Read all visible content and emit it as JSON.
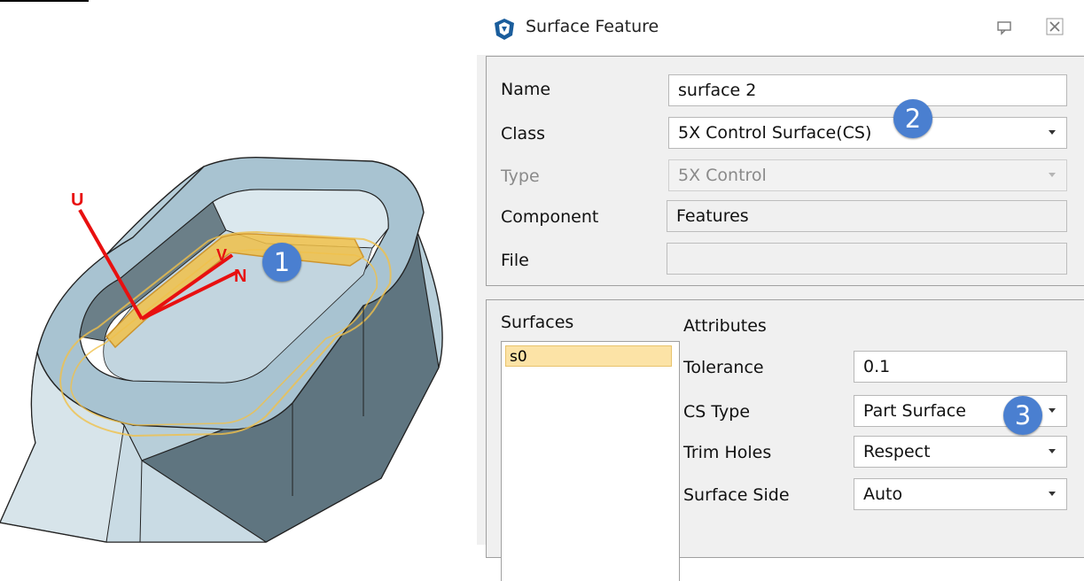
{
  "dialog": {
    "title": "Surface Feature",
    "icons": {
      "app": "surface-feature-icon",
      "pin": "pin-icon",
      "close": "close-icon"
    }
  },
  "properties": {
    "name_label": "Name",
    "name_value": "surface 2",
    "class_label": "Class",
    "class_value": "5X Control Surface(CS)",
    "type_label": "Type",
    "type_value": "5X Control",
    "component_label": "Component",
    "component_value": "Features",
    "file_label": "File",
    "file_value": ""
  },
  "surfaces": {
    "header": "Surfaces",
    "items": [
      "s0"
    ]
  },
  "attributes": {
    "header": "Attributes",
    "tolerance_label": "Tolerance",
    "tolerance_value": "0.1",
    "cs_type_label": "CS Type",
    "cs_type_value": "Part Surface",
    "trim_holes_label": "Trim Holes",
    "trim_holes_value": "Respect",
    "surface_side_label": "Surface Side",
    "surface_side_value": "Auto"
  },
  "viewport": {
    "axis_labels": {
      "u": "U",
      "v": "V",
      "n": "N"
    },
    "colors": {
      "part": "#a8c3d1",
      "selection": "#f0b020",
      "axis": "#e81010"
    }
  },
  "callouts": [
    "1",
    "2",
    "3"
  ],
  "colors": {
    "badge": "#4a7fd0",
    "selected_item": "#fce3a6"
  }
}
